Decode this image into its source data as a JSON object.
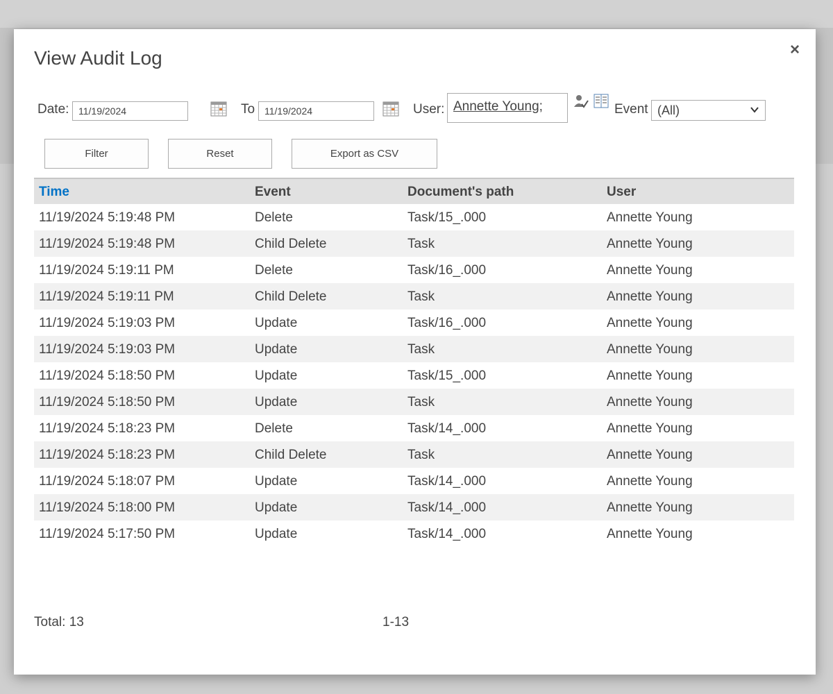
{
  "dialog": {
    "title": "View Audit Log",
    "close_label": "×"
  },
  "filters": {
    "date_label": "Date:",
    "date_from": "11/19/2024",
    "to_label": "To",
    "date_to": "11/19/2024",
    "user_label": "User:",
    "user_value": "Annette Young;",
    "event_label": "Event",
    "event_value": "(All)"
  },
  "buttons": {
    "filter": "Filter",
    "reset": "Reset",
    "export": "Export as CSV"
  },
  "table": {
    "columns": [
      "Time",
      "Event",
      "Document's path",
      "User"
    ],
    "rows": [
      [
        "11/19/2024 5:19:48 PM",
        "Delete",
        "Task/15_.000",
        "Annette Young"
      ],
      [
        "11/19/2024 5:19:48 PM",
        "Child Delete",
        "Task",
        "Annette Young"
      ],
      [
        "11/19/2024 5:19:11 PM",
        "Delete",
        "Task/16_.000",
        "Annette Young"
      ],
      [
        "11/19/2024 5:19:11 PM",
        "Child Delete",
        "Task",
        "Annette Young"
      ],
      [
        "11/19/2024 5:19:03 PM",
        "Update",
        "Task/16_.000",
        "Annette Young"
      ],
      [
        "11/19/2024 5:19:03 PM",
        "Update",
        "Task",
        "Annette Young"
      ],
      [
        "11/19/2024 5:18:50 PM",
        "Update",
        "Task/15_.000",
        "Annette Young"
      ],
      [
        "11/19/2024 5:18:50 PM",
        "Update",
        "Task",
        "Annette Young"
      ],
      [
        "11/19/2024 5:18:23 PM",
        "Delete",
        "Task/14_.000",
        "Annette Young"
      ],
      [
        "11/19/2024 5:18:23 PM",
        "Child Delete",
        "Task",
        "Annette Young"
      ],
      [
        "11/19/2024 5:18:07 PM",
        "Update",
        "Task/14_.000",
        "Annette Young"
      ],
      [
        "11/19/2024 5:18:00 PM",
        "Update",
        "Task/14_.000",
        "Annette Young"
      ],
      [
        "11/19/2024 5:17:50 PM",
        "Update",
        "Task/14_.000",
        "Annette Young"
      ]
    ]
  },
  "footer": {
    "total": "Total: 13",
    "range": "1-13"
  },
  "colors": {
    "accent": "#0072c6",
    "header_bg": "#e1e1e1",
    "alt_row_bg": "#f1f1f1"
  }
}
